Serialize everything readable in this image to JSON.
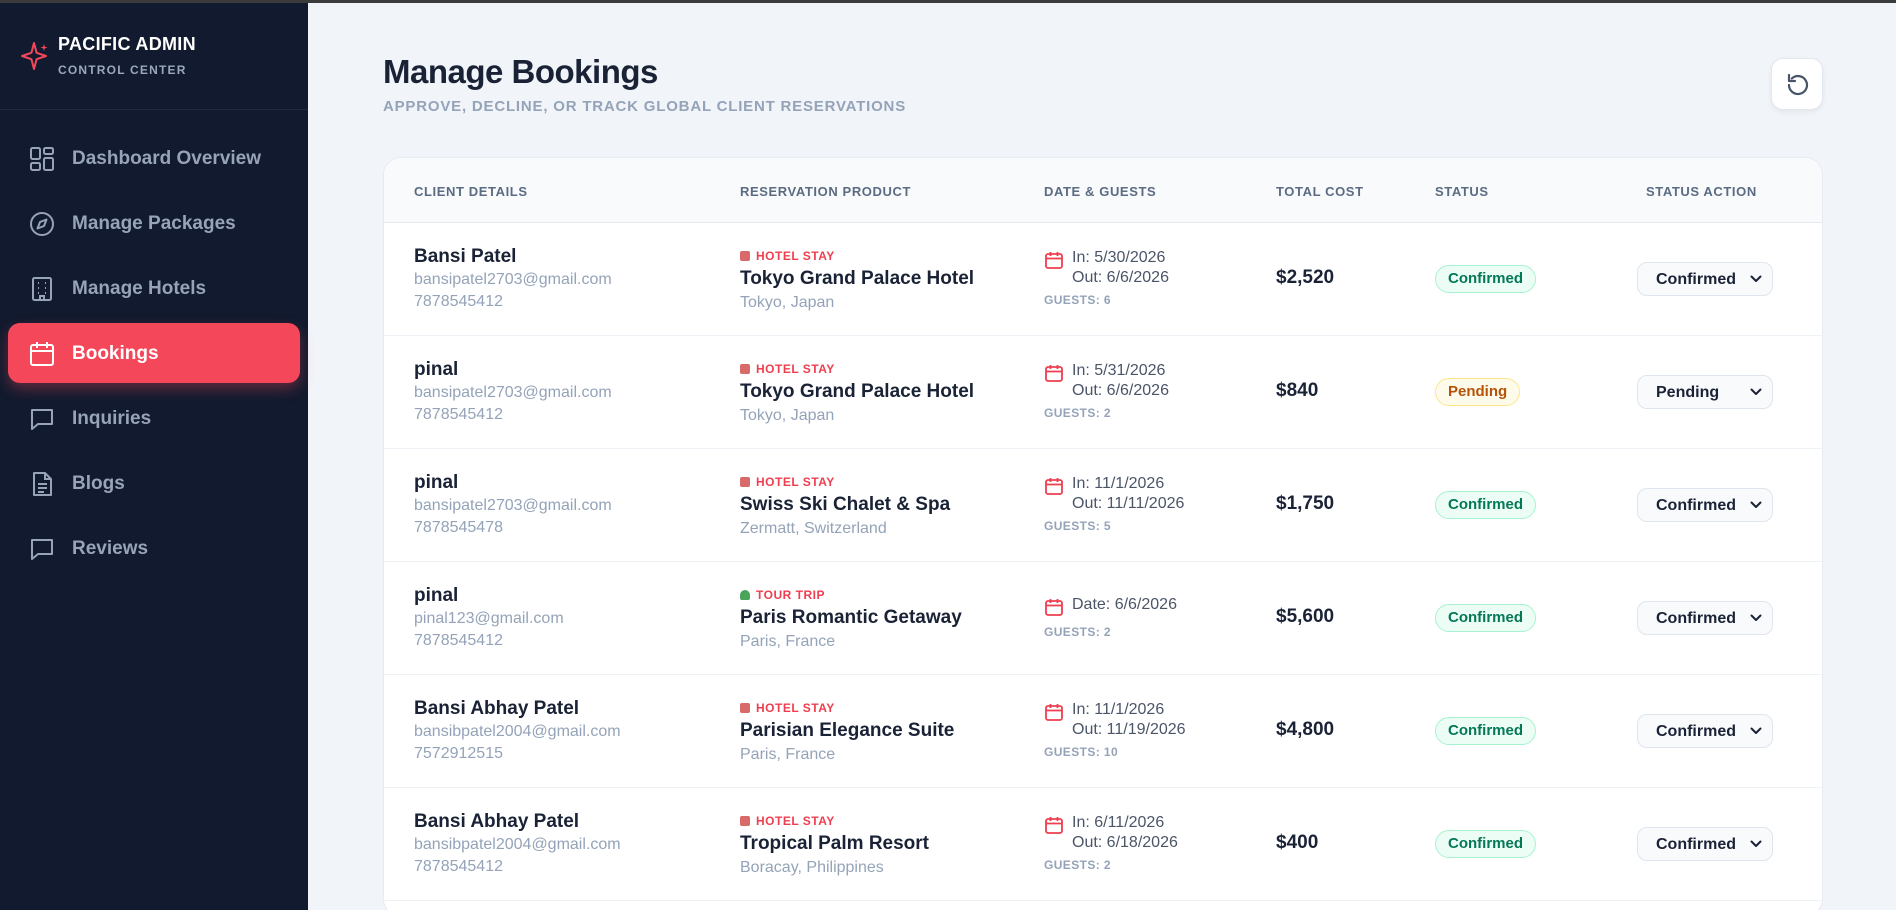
{
  "brand": {
    "title": "PACIFIC ADMIN",
    "subtitle": "CONTROL CENTER",
    "accent": "#f5475a"
  },
  "sidebar": {
    "items": [
      {
        "label": "Dashboard Overview",
        "icon": "dashboard-grid-icon",
        "active": false
      },
      {
        "label": "Manage Packages",
        "icon": "compass-icon",
        "active": false
      },
      {
        "label": "Manage Hotels",
        "icon": "building-icon",
        "active": false
      },
      {
        "label": "Bookings",
        "icon": "calendar-icon",
        "active": true
      },
      {
        "label": "Inquiries",
        "icon": "chat-bubble-icon",
        "active": false
      },
      {
        "label": "Blogs",
        "icon": "document-icon",
        "active": false
      },
      {
        "label": "Reviews",
        "icon": "chat-bubble-icon",
        "active": false
      }
    ]
  },
  "header": {
    "title": "Manage Bookings",
    "subtitle": "APPROVE, DECLINE, OR TRACK GLOBAL CLIENT RESERVATIONS",
    "refresh_icon": "refresh-icon"
  },
  "table": {
    "columns": [
      "CLIENT DETAILS",
      "RESERVATION PRODUCT",
      "DATE & GUESTS",
      "TOTAL COST",
      "STATUS",
      "STATUS ACTION"
    ],
    "rows": [
      {
        "name": "Bansi Patel",
        "email": "bansipatel2703@gmail.com",
        "phone": "7878545412",
        "type": "HOTEL STAY",
        "kind": "hotel",
        "product": "Tokyo Grand Palace Hotel",
        "location": "Tokyo, Japan",
        "date_in": "In: 5/30/2026",
        "date_out": "Out: 6/6/2026",
        "date": null,
        "guests": "GUESTS: 6",
        "cost": "$2,520",
        "status": "Confirmed",
        "action": "Confirmed"
      },
      {
        "name": "pinal",
        "email": "bansipatel2703@gmail.com",
        "phone": "7878545412",
        "type": "HOTEL STAY",
        "kind": "hotel",
        "product": "Tokyo Grand Palace Hotel",
        "location": "Tokyo, Japan",
        "date_in": "In: 5/31/2026",
        "date_out": "Out: 6/6/2026",
        "date": null,
        "guests": "GUESTS: 2",
        "cost": "$840",
        "status": "Pending",
        "action": "Pending"
      },
      {
        "name": "pinal",
        "email": "bansipatel2703@gmail.com",
        "phone": "7878545478",
        "type": "HOTEL STAY",
        "kind": "hotel",
        "product": "Swiss Ski Chalet & Spa",
        "location": "Zermatt, Switzerland",
        "date_in": "In: 11/1/2026",
        "date_out": "Out: 11/11/2026",
        "date": null,
        "guests": "GUESTS: 5",
        "cost": "$1,750",
        "status": "Confirmed",
        "action": "Confirmed"
      },
      {
        "name": "pinal",
        "email": "pinal123@gmail.com",
        "phone": "7878545412",
        "type": "TOUR TRIP",
        "kind": "tour",
        "product": "Paris Romantic Getaway",
        "location": "Paris, France",
        "date_in": null,
        "date_out": null,
        "date": "Date: 6/6/2026",
        "guests": "GUESTS: 2",
        "cost": "$5,600",
        "status": "Confirmed",
        "action": "Confirmed"
      },
      {
        "name": "Bansi Abhay Patel",
        "email": "bansibpatel2004@gmail.com",
        "phone": "7572912515",
        "type": "HOTEL STAY",
        "kind": "hotel",
        "product": "Parisian Elegance Suite",
        "location": "Paris, France",
        "date_in": "In: 11/1/2026",
        "date_out": "Out: 11/19/2026",
        "date": null,
        "guests": "GUESTS: 10",
        "cost": "$4,800",
        "status": "Confirmed",
        "action": "Confirmed"
      },
      {
        "name": "Bansi Abhay Patel",
        "email": "bansibpatel2004@gmail.com",
        "phone": "7878545412",
        "type": "HOTEL STAY",
        "kind": "hotel",
        "product": "Tropical Palm Resort",
        "location": "Boracay, Philippines",
        "date_in": "In: 6/11/2026",
        "date_out": "Out: 6/18/2026",
        "date": null,
        "guests": "GUESTS: 2",
        "cost": "$400",
        "status": "Confirmed",
        "action": "Confirmed"
      }
    ]
  }
}
